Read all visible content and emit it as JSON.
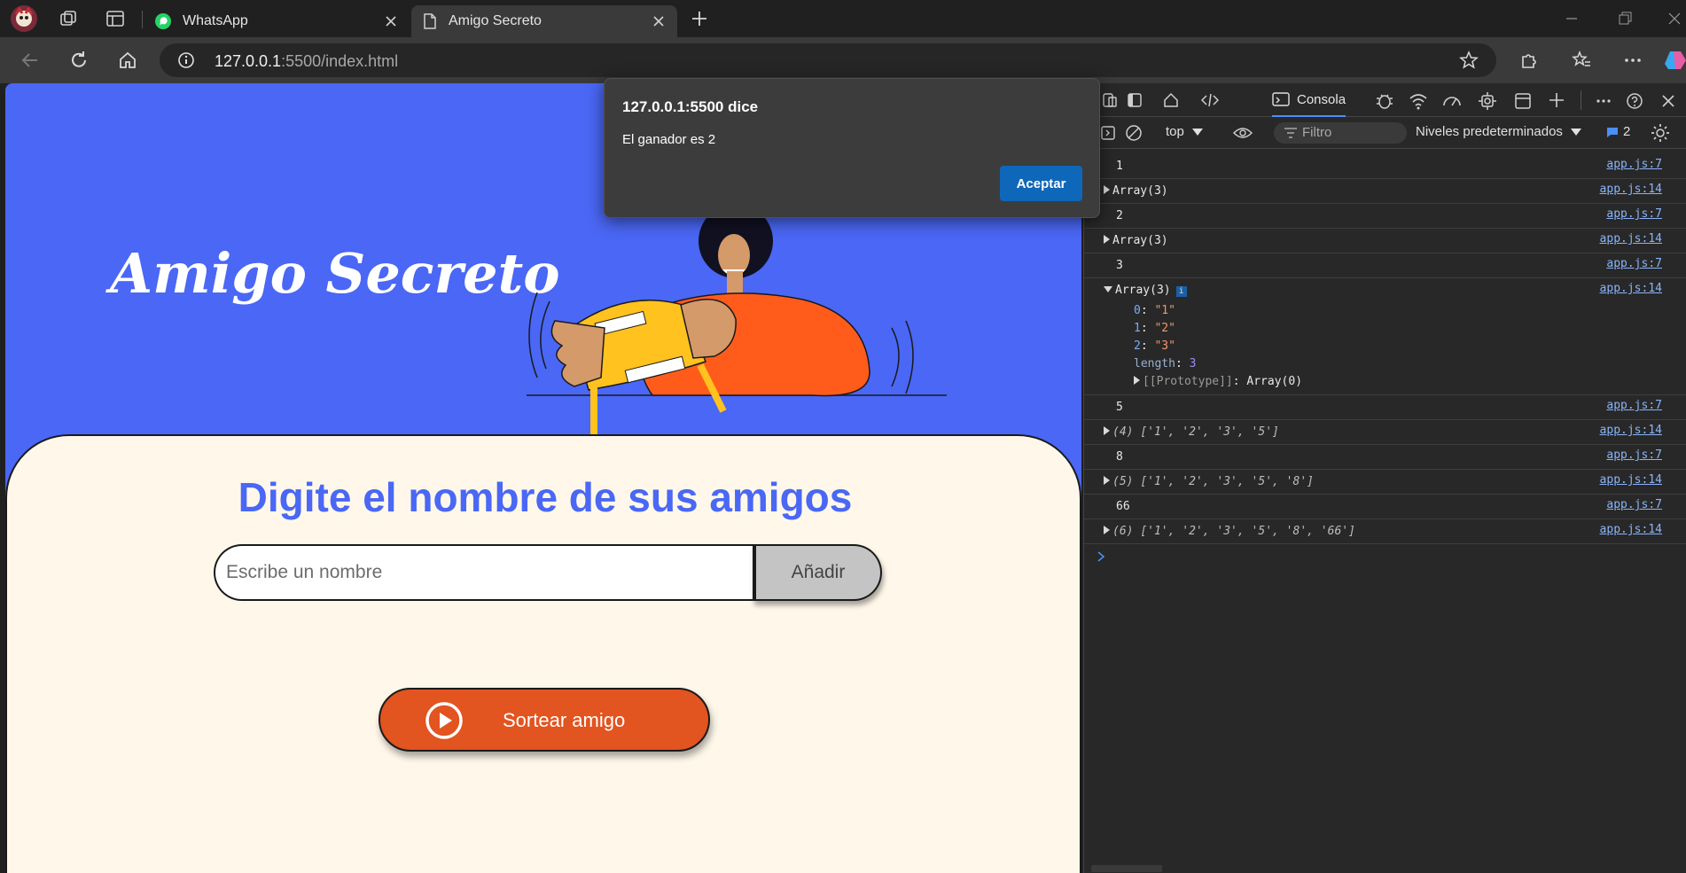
{
  "browser": {
    "tabs": [
      {
        "title": "WhatsApp"
      },
      {
        "title": "Amigo Secreto"
      }
    ],
    "url_host": "127.0.0.1",
    "url_rest": ":5500/index.html"
  },
  "page": {
    "title": "Amigo Secreto",
    "heading": "Digite el nombre de sus amigos",
    "input_placeholder": "Escribe un nombre",
    "add_label": "Añadir",
    "draw_label": "Sortear amigo"
  },
  "dialog": {
    "title": "127.0.0.1:5500 dice",
    "message": "El ganador es 2",
    "ok_label": "Aceptar"
  },
  "devtools": {
    "console_tab": "Consola",
    "context": "top",
    "filter_placeholder": "Filtro",
    "levels": "Niveles predeterminados",
    "issues_count": "2",
    "logs": [
      {
        "text": "1",
        "src": "app.js:7"
      },
      {
        "text": "Array(3)",
        "src": "app.js:14"
      },
      {
        "text": "2",
        "src": "app.js:7"
      },
      {
        "text": "Array(3)",
        "src": "app.js:14"
      },
      {
        "text": "3",
        "src": "app.js:7"
      },
      {
        "text": "Array(3)",
        "src": "app.js:14",
        "entries": [
          {
            "k": "0",
            "v": "\"1\""
          },
          {
            "k": "1",
            "v": "\"2\""
          },
          {
            "k": "2",
            "v": "\"3\""
          }
        ],
        "length_key": "length",
        "length_val": "3",
        "proto_key": "[[Prototype]]",
        "proto_val": "Array(0)"
      },
      {
        "text": "5",
        "src": "app.js:7"
      },
      {
        "prefix": "(4)",
        "text": "['1', '2', '3', '5']",
        "src": "app.js:14"
      },
      {
        "text": "8",
        "src": "app.js:7"
      },
      {
        "prefix": "(5)",
        "text": "['1', '2', '3', '5', '8']",
        "src": "app.js:14"
      },
      {
        "text": "66",
        "src": "app.js:7"
      },
      {
        "prefix": "(6)",
        "text": "['1', '2', '3', '5', '8', '66']",
        "src": "app.js:14"
      }
    ]
  }
}
